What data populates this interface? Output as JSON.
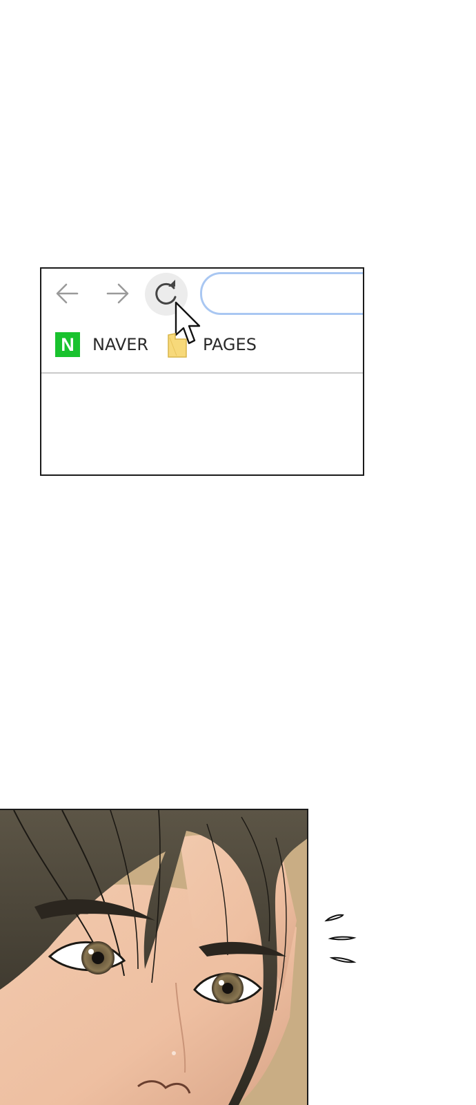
{
  "browser": {
    "toolbar": {
      "back_icon": "arrow-left-icon",
      "forward_icon": "arrow-right-icon",
      "reload_icon": "reload-icon",
      "address_value": ""
    },
    "bookmarks": [
      {
        "label": "NAVER",
        "icon": "naver-logo",
        "logo_letter": "N",
        "logo_color": "#19c22e"
      },
      {
        "label": "PAGES",
        "icon": "folder-icon",
        "icon_color": "#f7d97a"
      }
    ],
    "colors": {
      "address_border": "#a9c7f2",
      "reload_hover_bg": "#ececec"
    }
  },
  "comic": {
    "illustration": "close-up-face-illustration",
    "effect": "surprise-motion-lines"
  }
}
